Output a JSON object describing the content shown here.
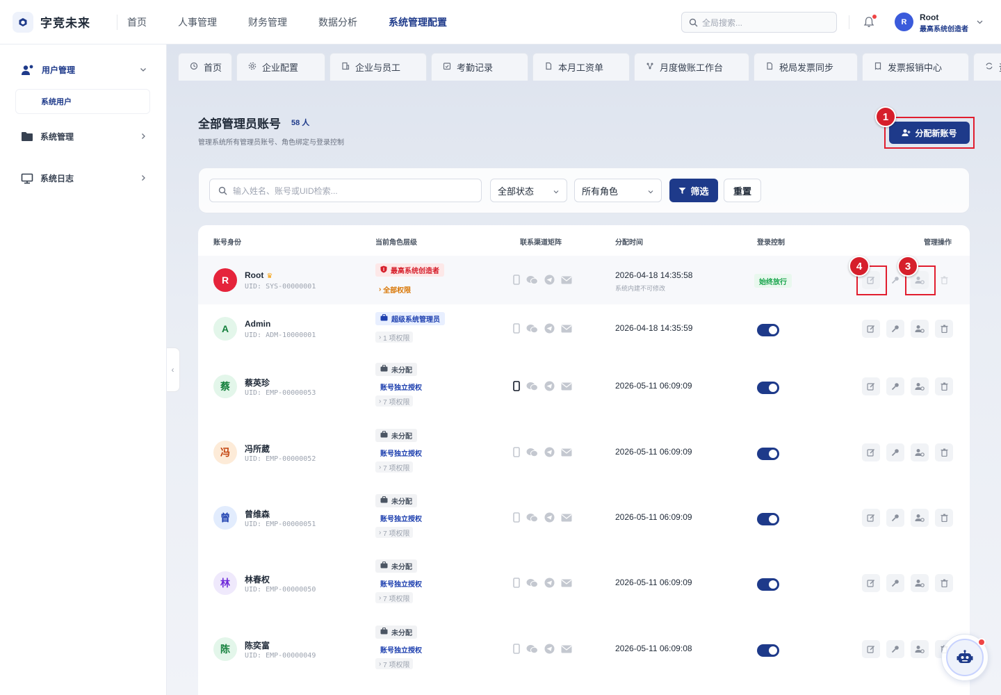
{
  "app": {
    "name": "字竞未来"
  },
  "topnav": [
    "首页",
    "人事管理",
    "财务管理",
    "数据分析",
    "系统管理配置"
  ],
  "search": {
    "placeholder": "全局搜索..."
  },
  "user": {
    "name": "Root",
    "role": "最高系统创造者",
    "avatar": "R"
  },
  "sidebar": {
    "groups": [
      {
        "label": "用户管理",
        "icon": "users-icon",
        "sub": "系统用户"
      },
      {
        "label": "系统管理",
        "icon": "folder-icon"
      },
      {
        "label": "系统日志",
        "icon": "monitor-icon"
      }
    ]
  },
  "tabs": [
    "首页",
    "企业配置",
    "企业与员工",
    "考勤记录",
    "本月工资单",
    "月度做账工作台",
    "税局发票同步",
    "发票报销中心",
    "资"
  ],
  "page": {
    "title": "全部管理员账号",
    "count": "58 人",
    "subtitle": "管理系统所有管理员账号、角色绑定与登录控制",
    "add_button": "分配新账号"
  },
  "filters": {
    "search_placeholder": "输入姓名、账号或UID检索...",
    "status": "全部状态",
    "role": "所有角色",
    "filter_button": "筛选",
    "reset_button": "重置"
  },
  "table": {
    "headers": [
      "账号身份",
      "当前角色层级",
      "联系渠道矩阵",
      "分配时间",
      "登录控制",
      "管理操作"
    ],
    "rows": [
      {
        "avatar": "R",
        "name": "Root",
        "uid": "UID: SYS-00000001",
        "role": "最高系统创造者",
        "perm": "全部权限",
        "time": "2026-04-18 14:35:58",
        "time_note": "系统内建不可修改",
        "login": "始终放行"
      },
      {
        "avatar": "A",
        "name": "Admin",
        "uid": "UID: ADM-10000001",
        "role": "超级系统管理员",
        "perm": "1 项权限",
        "time": "2026-04-18 14:35:59"
      },
      {
        "avatar": "蔡",
        "name": "蔡英珍",
        "uid": "UID: EMP-00000053",
        "role": "未分配",
        "sub": "账号独立授权",
        "perm": "7 项权限",
        "time": "2026-05-11 06:09:09"
      },
      {
        "avatar": "冯",
        "name": "冯所葳",
        "uid": "UID: EMP-00000052",
        "role": "未分配",
        "sub": "账号独立授权",
        "perm": "7 项权限",
        "time": "2026-05-11 06:09:09"
      },
      {
        "avatar": "曾",
        "name": "曾维森",
        "uid": "UID: EMP-00000051",
        "role": "未分配",
        "sub": "账号独立授权",
        "perm": "7 项权限",
        "time": "2026-05-11 06:09:09"
      },
      {
        "avatar": "林",
        "name": "林春权",
        "uid": "UID: EMP-00000050",
        "role": "未分配",
        "sub": "账号独立授权",
        "perm": "7 项权限",
        "time": "2026-05-11 06:09:09"
      },
      {
        "avatar": "陈",
        "name": "陈奕富",
        "uid": "UID: EMP-00000049",
        "role": "未分配",
        "sub": "账号独立授权",
        "perm": "7 项权限",
        "time": "2026-05-11 06:09:08"
      }
    ]
  },
  "markers": [
    "1",
    "4",
    "3"
  ],
  "colors": {
    "primary": "#1e3a8a",
    "danger": "#d61f2b",
    "success": "#16a34a"
  }
}
